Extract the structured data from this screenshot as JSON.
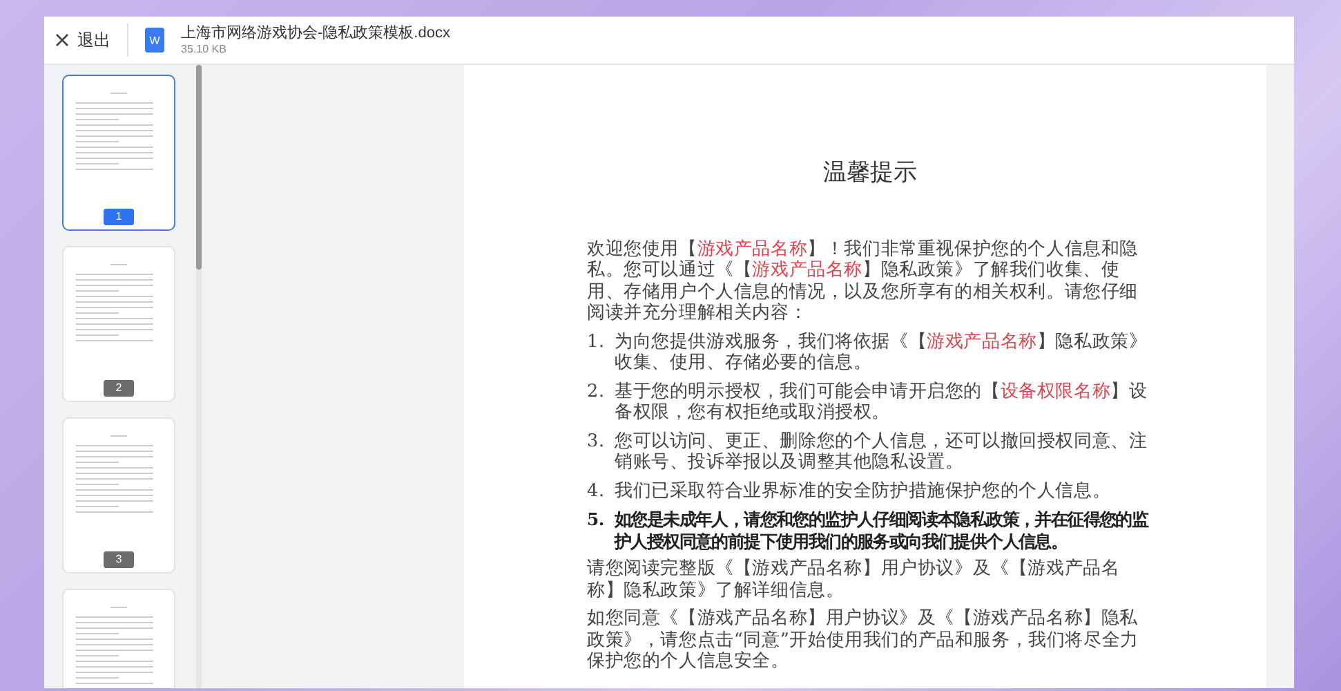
{
  "header": {
    "close_label": "退出",
    "file_icon_letter": "W",
    "file_name": "上海市网络游戏协会-隐私政策模板.docx",
    "file_size": "35.10 KB"
  },
  "thumbnails": [
    {
      "page": "1",
      "selected": true
    },
    {
      "page": "2",
      "selected": false
    },
    {
      "page": "3",
      "selected": false
    },
    {
      "selected": false
    }
  ],
  "document": {
    "title": "温馨提示",
    "blocks": [
      {
        "kind": "para",
        "bold": false,
        "segments": [
          {
            "text": "欢迎您使用",
            "highlight": false
          },
          {
            "text": "【",
            "highlight": false
          },
          {
            "text": "游戏产品名称",
            "highlight": true
          },
          {
            "text": "】！我们非常重视保护您的个人信息和隐私。您可以通过《",
            "highlight": false
          },
          {
            "text": "【",
            "highlight": false
          },
          {
            "text": "游戏产品名称",
            "highlight": true
          },
          {
            "text": "】隐私政策》了解我们收集、使用、存储用户个人信息的情况，以及您所享有的相关权利。请您仔细阅读并充分理解相关内容：",
            "highlight": false
          }
        ]
      },
      {
        "kind": "item",
        "number": "1.",
        "bold": false,
        "segments": [
          {
            "text": "为向您提供游戏服务，我们将依据《【",
            "highlight": false
          },
          {
            "text": "游戏产品名称",
            "highlight": true
          },
          {
            "text": "】隐私政策》收集、使用、存储必要的信息。",
            "highlight": false
          }
        ]
      },
      {
        "kind": "item",
        "number": "2.",
        "bold": false,
        "segments": [
          {
            "text": "基于您的明示授权，我们可能会申请开启您的【",
            "highlight": false
          },
          {
            "text": "设备权限名称",
            "highlight": true
          },
          {
            "text": "】设备权限，您有权拒绝或取消授权。",
            "highlight": false
          }
        ]
      },
      {
        "kind": "item",
        "number": "3.",
        "bold": false,
        "segments": [
          {
            "text": "您可以访问、更正、删除您的个人信息，还可以撤回授权同意、注销账号、投诉举报以及调整其他隐私设置。",
            "highlight": false
          }
        ]
      },
      {
        "kind": "item",
        "number": "4.",
        "bold": false,
        "segments": [
          {
            "text": "我们已采取符合业界标准的安全防护措施保护您的个人信息。",
            "highlight": false
          }
        ]
      },
      {
        "kind": "item",
        "number": "5.",
        "bold": true,
        "segments": [
          {
            "text": "如您是未成年人，请您和您的监护人仔细阅读本隐私政策，并在征得您的监护人授权同意的前提下使用我们的服务或向我们提供个人信息。",
            "highlight": false
          }
        ]
      },
      {
        "kind": "para",
        "bold": false,
        "segments": [
          {
            "text": "请您阅读完整版《【游戏产品名称】用户协议》及《【游戏产品名称】隐私政策》了解详细信息。",
            "highlight": false
          }
        ]
      },
      {
        "kind": "para",
        "bold": false,
        "segments": [
          {
            "text": "如您同意《【游戏产品名称】用户协议》及《【游戏产品名称】隐私政策》，请您点击“同意”开始使用我们的产品和服务，我们将尽全力保护您的个人信息安全。",
            "highlight": false
          }
        ]
      }
    ]
  }
}
